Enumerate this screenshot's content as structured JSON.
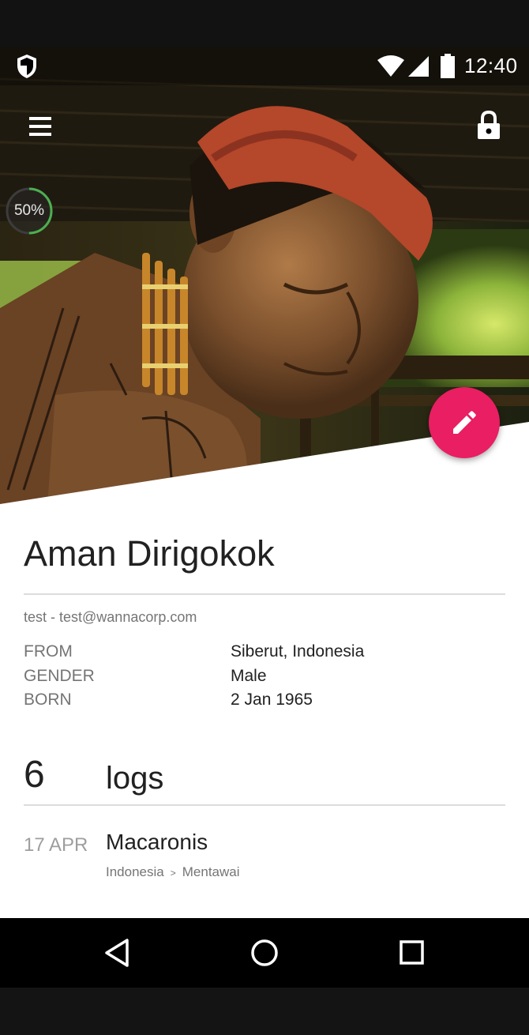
{
  "status_bar": {
    "time": "12:40",
    "icons": [
      "shield-icon",
      "wifi-icon",
      "signal-icon",
      "battery-icon"
    ]
  },
  "toolbar": {
    "menu_icon": "menu-icon",
    "lock_icon": "lock-icon"
  },
  "progress": {
    "label": "50%",
    "value": 0.5,
    "color": "#4caf50"
  },
  "fab": {
    "icon": "pencil-icon",
    "color": "#e91e63"
  },
  "profile": {
    "name": "Aman Dirigokok",
    "subtitle": "test - test@wannacorp.com",
    "fields": [
      {
        "label": "FROM",
        "value": "Siberut, Indonesia"
      },
      {
        "label": "GENDER",
        "value": "Male"
      },
      {
        "label": "BORN",
        "value": "2 Jan 1965"
      }
    ]
  },
  "logs": {
    "count": "6",
    "label": "logs",
    "items": [
      {
        "date": "17 APR",
        "title": "Macaronis",
        "path": [
          "Indonesia",
          "Mentawai"
        ],
        "separator": ">"
      }
    ]
  },
  "nav_bar": {
    "icons": [
      "back-icon",
      "home-icon",
      "recents-icon"
    ]
  }
}
